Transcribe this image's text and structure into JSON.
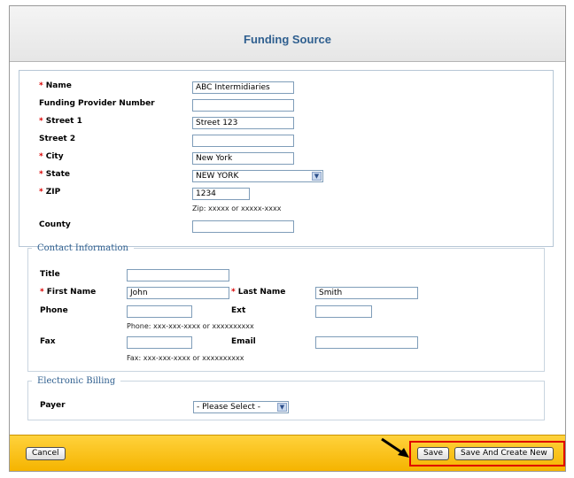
{
  "header": {
    "title": "Funding Source"
  },
  "provider": {
    "name": {
      "label": "Name",
      "value": "ABC Intermidiaries"
    },
    "funding_provider_number": {
      "label": "Funding Provider Number",
      "value": ""
    },
    "street1": {
      "label": "Street 1",
      "value": "Street 123"
    },
    "street2": {
      "label": "Street 2",
      "value": ""
    },
    "city": {
      "label": "City",
      "value": "New York"
    },
    "state": {
      "label": "State",
      "value": "NEW YORK"
    },
    "zip": {
      "label": "ZIP",
      "value": "1234",
      "hint": "Zip: xxxxx or xxxxx-xxxx"
    },
    "county": {
      "label": "County",
      "value": ""
    },
    "required_mark": "*"
  },
  "contact": {
    "legend": "Contact Information",
    "title": {
      "label": "Title",
      "value": ""
    },
    "first_name": {
      "label": "First Name",
      "value": "John"
    },
    "last_name": {
      "label": "Last Name",
      "value": "Smith"
    },
    "phone": {
      "label": "Phone",
      "value": "",
      "hint": "Phone: xxx-xxx-xxxx or xxxxxxxxxx"
    },
    "ext": {
      "label": "Ext",
      "value": ""
    },
    "fax": {
      "label": "Fax",
      "value": "",
      "hint": "Fax: xxx-xxx-xxxx or xxxxxxxxxx"
    },
    "email": {
      "label": "Email",
      "value": ""
    }
  },
  "billing": {
    "legend": "Electronic Billing",
    "payer": {
      "label": "Payer",
      "value": "- Please Select -"
    }
  },
  "footer": {
    "cancel": "Cancel",
    "save": "Save",
    "save_new": "Save And Create New"
  },
  "colors": {
    "accent": "#2f5f8f",
    "footer": "#f5b400",
    "required": "#d90000",
    "highlight": "#e00000"
  }
}
